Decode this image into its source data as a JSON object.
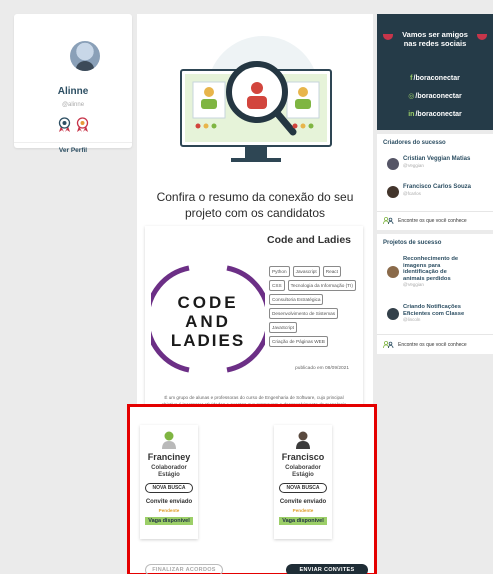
{
  "profile": {
    "name": "Alinne",
    "username": "@alinne",
    "view_profile": "Ver Perfil"
  },
  "main": {
    "headline_line1": "Confira o resumo da conexão do seu",
    "headline_line2": "projeto com os candidatos",
    "project": {
      "title": "Code and Ladies",
      "logo_lines": [
        "CODE",
        "AND",
        "LADIES"
      ],
      "tags": [
        "Python",
        "Javascript",
        "React",
        "CSS",
        "Tecnologia da Informação (TI)",
        "Consultoria Estratégica",
        "Desenvolvimento de Sistemas",
        "JavaScript",
        "Criação de Páginas WEB"
      ],
      "date": "publicado em 08/09/2021",
      "description": "É um grupo de alunas e professoras do curso de Engenharia de Software, cujo principal objetivo é incorporar atividades e eventos que promovam o desenvolvimento da tecnologia entre o público feminino no ambiente do Paraná."
    },
    "candidates": [
      {
        "name": "Franciney",
        "role_line1": "Colaborador",
        "role_line2": "Estágio",
        "button": "NOVA BUSCA",
        "status": "Convite enviado",
        "pending": "Pendente",
        "vaga": "Vaga disponível"
      },
      {
        "name": "Francisco",
        "role_line1": "Colaborador",
        "role_line2": "Estágio",
        "button": "NOVA BUSCA",
        "status": "Convite enviado",
        "pending": "Pendente",
        "vaga": "Vaga disponível"
      }
    ],
    "finalize_button": "FINALIZAR ACORDOS",
    "send_button": "ENVIAR CONVITES"
  },
  "social": {
    "title_line1": "Vamos ser amigos",
    "title_line2": "nas redes sociais",
    "links": [
      {
        "icon": "f",
        "label": "/boraconectar"
      },
      {
        "icon": "◎",
        "label": "/boraconectar"
      },
      {
        "icon": "in",
        "label": "/boraconectar"
      }
    ]
  },
  "creators": {
    "title": "Criadores do sucesso",
    "items": [
      {
        "name": "Cristian Veggian Matias",
        "user": "@Veggian"
      },
      {
        "name": "Francisco Carlos Souza",
        "user": "@fcarlos"
      }
    ],
    "find_text": "Encontre os que você conhece"
  },
  "projects": {
    "title": "Projetos de sucesso",
    "items": [
      {
        "name_lines": [
          "Reconhecimento de",
          "imagens para",
          "identificação de",
          "animais perdidos"
        ],
        "user": "@Veggian"
      },
      {
        "name_lines": [
          "Criando Notificações",
          "Eficientes com Classe"
        ],
        "user": "@lincoln"
      }
    ],
    "find_text": "Encontre os que você conhece"
  },
  "colors": {
    "dark": "#253b48",
    "accent_green": "#9ccf68",
    "highlight_red": "#e40000",
    "pending_orange": "#e0a030"
  }
}
